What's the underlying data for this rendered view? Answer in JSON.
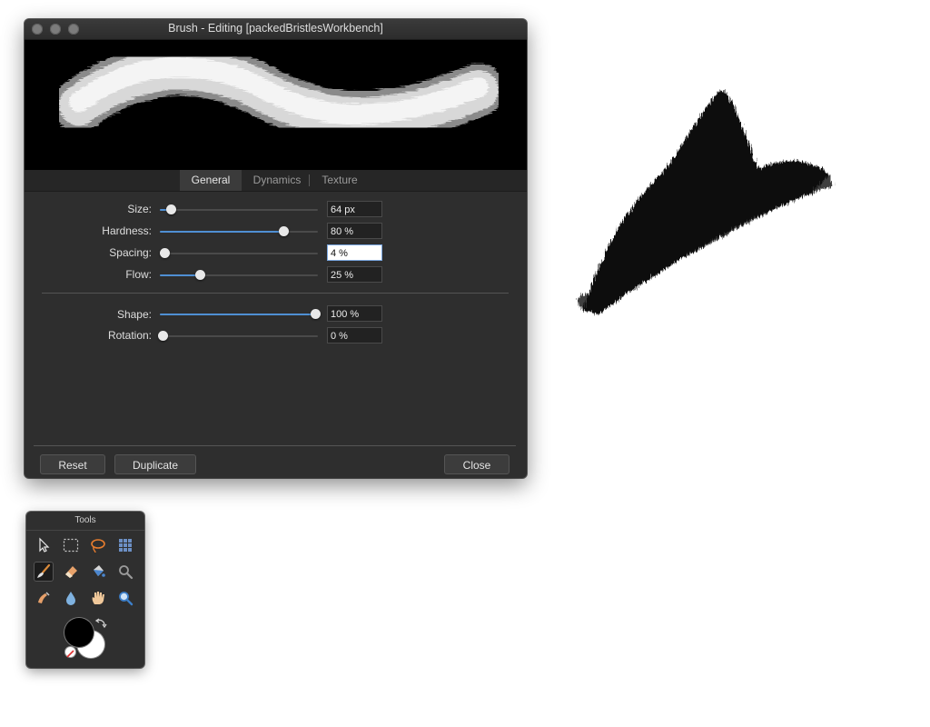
{
  "dialog": {
    "title": "Brush - Editing [packedBristlesWorkbench]",
    "tabs": [
      {
        "label": "General",
        "active": true
      },
      {
        "label": "Dynamics",
        "active": false
      },
      {
        "label": "Texture",
        "active": false
      }
    ],
    "settings": {
      "size": {
        "label": "Size:",
        "value": "64 px",
        "fraction": 0.07
      },
      "hardness": {
        "label": "Hardness:",
        "value": "80 %",
        "fraction": 0.78
      },
      "spacing": {
        "label": "Spacing:",
        "value": "4 %",
        "fraction": 0.03
      },
      "flow": {
        "label": "Flow:",
        "value": "25 %",
        "fraction": 0.25
      },
      "shape": {
        "label": "Shape:",
        "value": "100 %",
        "fraction": 0.98
      },
      "rotation": {
        "label": "Rotation:",
        "value": "0 %",
        "fraction": 0.02
      }
    },
    "buttons": {
      "reset": "Reset",
      "duplicate": "Duplicate",
      "close": "Close"
    }
  },
  "tools_panel": {
    "title": "Tools",
    "tools": [
      "pointer-icon",
      "rectangle-marquee-icon",
      "lasso-icon",
      "grid-icon",
      "paint-brush-icon",
      "eraser-icon",
      "paint-bucket-icon",
      "magnifier-icon",
      "smudge-icon",
      "blur-drop-icon",
      "hand-icon",
      "zoom-icon"
    ],
    "active_tool": "paint-brush-icon",
    "primary_color": "#000000",
    "secondary_color": "#ffffff"
  },
  "colors": {
    "accent": "#4f8fd3",
    "dialog_bg": "#2e2e2e"
  }
}
